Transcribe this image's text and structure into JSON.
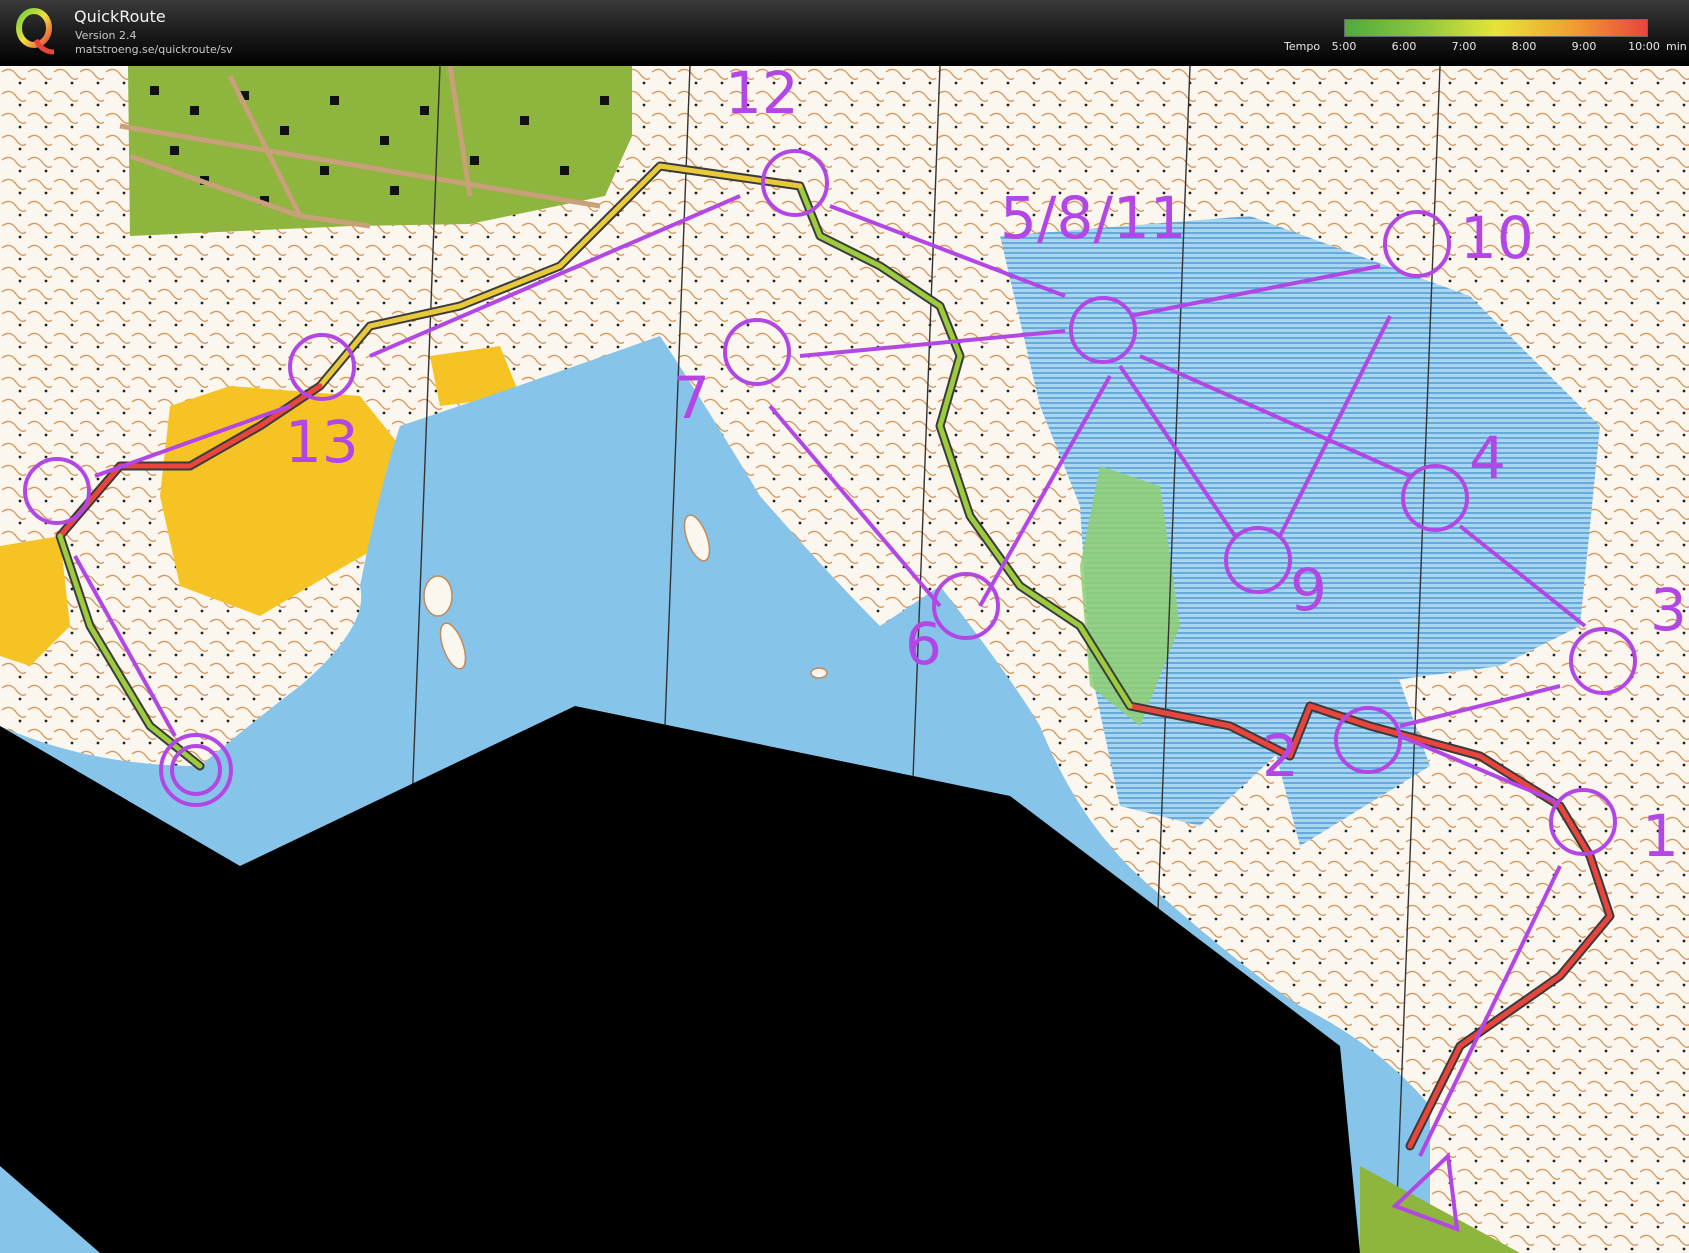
{
  "app": {
    "name": "QuickRoute",
    "version": "Version 2.4",
    "url": "matstroeng.se/quickroute/sv"
  },
  "legend": {
    "label": "Tempo",
    "ticks": [
      "5:00",
      "6:00",
      "7:00",
      "8:00",
      "9:00",
      "10:00"
    ],
    "unit": "min",
    "gradient": [
      "#4faa3c",
      "#8cc63f",
      "#e6e43a",
      "#f0a030",
      "#e8453c"
    ]
  },
  "colors": {
    "course": "#b347e6",
    "water": "#86c4ea",
    "open_land": "#f6c324",
    "settlement": "#8eb53e",
    "terrain": "#fbf6ee",
    "unmapped": "#000000"
  },
  "controls": [
    {
      "label": "1",
      "icon": "control-circle-icon"
    },
    {
      "label": "2",
      "icon": "control-circle-icon"
    },
    {
      "label": "3",
      "icon": "control-circle-icon"
    },
    {
      "label": "4",
      "icon": "control-circle-icon"
    },
    {
      "label": "5/8/11",
      "icon": "control-circle-icon"
    },
    {
      "label": "6",
      "icon": "control-circle-icon"
    },
    {
      "label": "7",
      "icon": "control-circle-icon"
    },
    {
      "label": "9",
      "icon": "control-circle-icon"
    },
    {
      "label": "10",
      "icon": "control-circle-icon"
    },
    {
      "label": "12",
      "icon": "control-circle-icon"
    },
    {
      "label": "13",
      "icon": "control-circle-icon"
    }
  ],
  "start_icon": "start-triangle-icon",
  "finish_icon": "finish-double-circle-icon"
}
